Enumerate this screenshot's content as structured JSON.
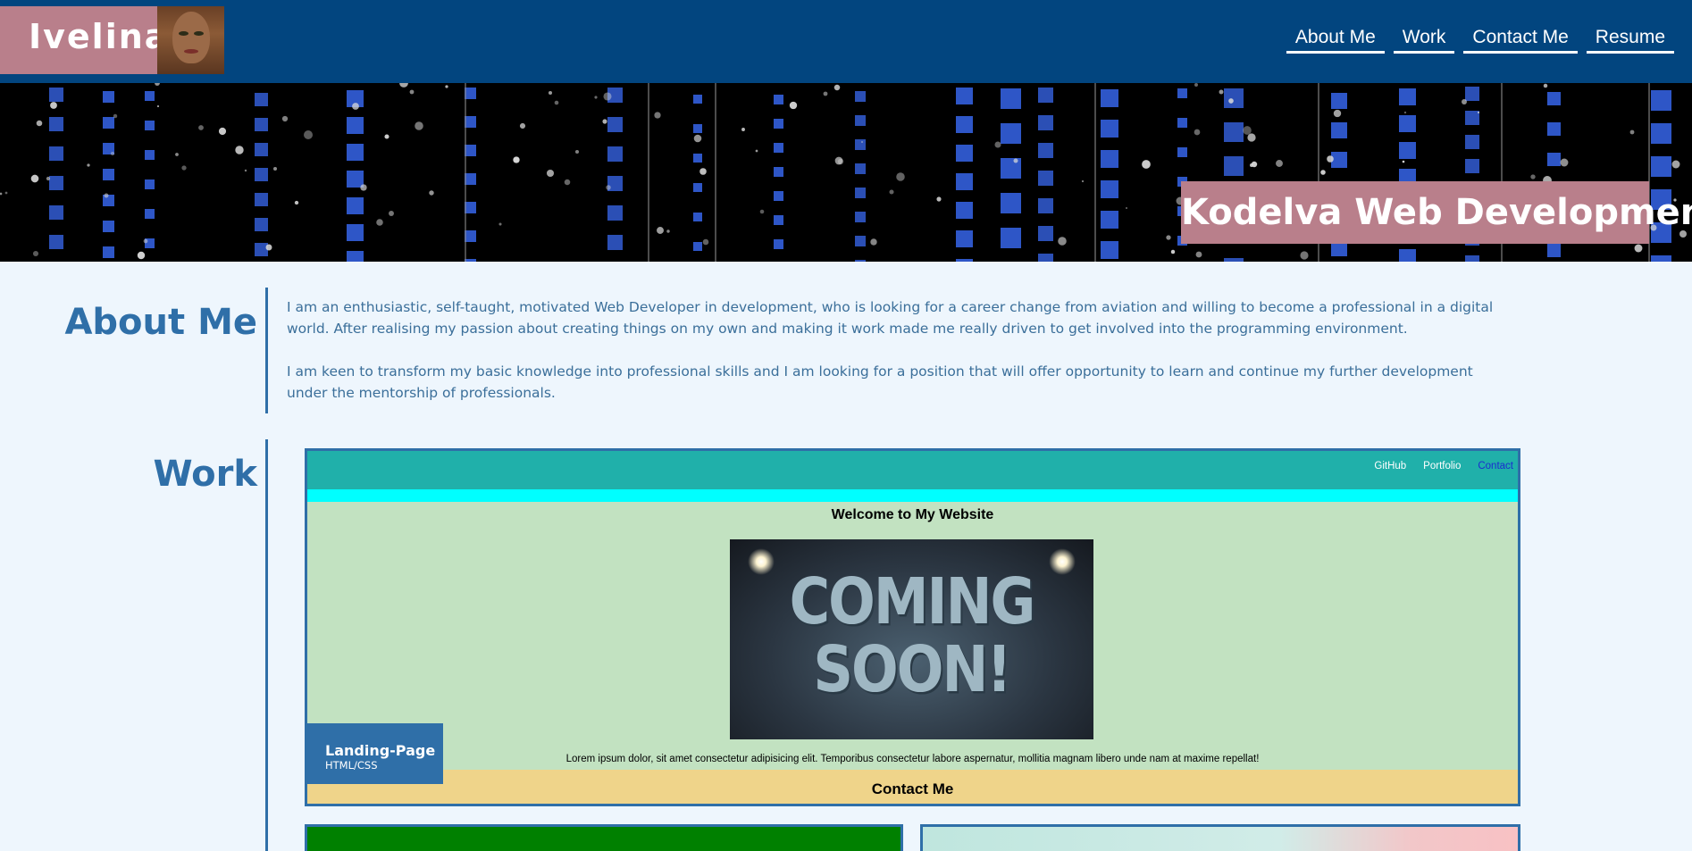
{
  "header": {
    "brand_name": "Ivelina",
    "nav": [
      {
        "label": "About Me"
      },
      {
        "label": "Work"
      },
      {
        "label": "Contact Me"
      },
      {
        "label": "Resume"
      }
    ]
  },
  "hero": {
    "title": "Kodelva Web Development!"
  },
  "about": {
    "heading": "About Me",
    "paragraphs": [
      "I am an enthusiastic, self-taught, motivated Web Developer in development, who is looking for a career change from aviation and willing to become a professional in a digital world. After realising my passion about creating things on my own and making it work made me really driven to get involved into the programming environment.",
      "I am keen to transform my basic knowledge into professional skills and I am looking for a position that will offer opportunity to learn and continue my further development under the mentorship of professionals."
    ]
  },
  "work": {
    "heading": "Work",
    "projects": [
      {
        "title": "Landing-Page",
        "tech": "HTML/CSS",
        "preview": {
          "nav": [
            "GitHub",
            "Portfolio",
            "Contact"
          ],
          "welcome": "Welcome to My Website",
          "image_text_line1": "COMING",
          "image_text_line2": "SOON!",
          "lorem": "Lorem ipsum dolor, sit amet consectetur adipisicing elit. Temporibus consectetur labore aspernatur, mollitia magnam libero unde nam at maxime repellat!",
          "contact": "Contact Me"
        }
      }
    ]
  },
  "colors": {
    "header_bg": "#02457f",
    "brand_bg": "#b97f8b",
    "accent": "#2f6fa8",
    "page_bg": "#eef6fd"
  }
}
